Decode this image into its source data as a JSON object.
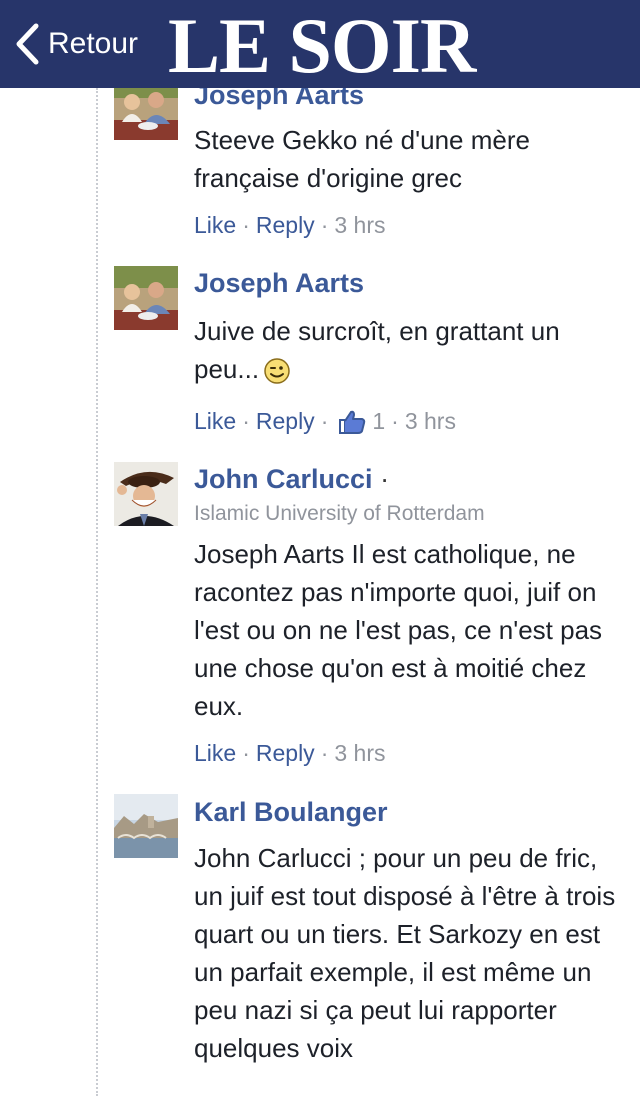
{
  "header": {
    "back_label": "Retour",
    "logo": "LE SOIR",
    "background": "#27356a"
  },
  "comments": [
    {
      "author": "Joseph Aarts",
      "text": "Steeve Gekko né d'une mère française d'origine grec",
      "like": "Like",
      "reply": "Reply",
      "time": "3 hrs"
    },
    {
      "author": "Joseph Aarts",
      "text": "Juive de surcroît, en grattant un peu...",
      "emoji": "wink-emoji",
      "like": "Like",
      "reply": "Reply",
      "likes_count": "1",
      "time": "3 hrs"
    },
    {
      "author": "John Carlucci",
      "affiliation": "Islamic University of Rotterdam",
      "text": "Joseph Aarts Il est catholique, ne racontez pas n'importe quoi, juif on l'est ou on ne l'est pas, ce n'est pas une chose qu'on est à moitié chez eux.",
      "like": "Like",
      "reply": "Reply",
      "time": "3 hrs"
    },
    {
      "author": "Karl Boulanger",
      "text": "John Carlucci ; pour un peu de fric, un juif est tout disposé à l'être à trois quart ou un tiers. Et Sarkozy en est un parfait exemple, il est même un peu nazi si ça peut lui rapporter quelques voix"
    }
  ],
  "colors": {
    "link": "#3b5998",
    "meta": "#90949c",
    "text": "#1d2129"
  }
}
